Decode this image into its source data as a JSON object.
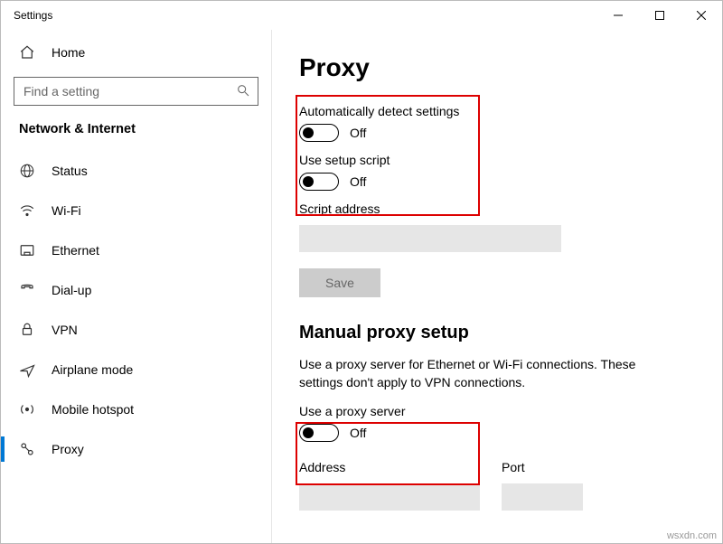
{
  "window": {
    "title": "Settings"
  },
  "sidebar": {
    "home": "Home",
    "search_placeholder": "Find a setting",
    "section": "Network & Internet",
    "items": [
      {
        "label": "Status"
      },
      {
        "label": "Wi-Fi"
      },
      {
        "label": "Ethernet"
      },
      {
        "label": "Dial-up"
      },
      {
        "label": "VPN"
      },
      {
        "label": "Airplane mode"
      },
      {
        "label": "Mobile hotspot"
      },
      {
        "label": "Proxy"
      }
    ]
  },
  "main": {
    "title": "Proxy",
    "auto_detect": {
      "label": "Automatically detect settings",
      "state": "Off"
    },
    "setup_script": {
      "label": "Use setup script",
      "state": "Off"
    },
    "script_address_label": "Script address",
    "save_label": "Save",
    "manual_title": "Manual proxy setup",
    "manual_desc": "Use a proxy server for Ethernet or Wi-Fi connections. These settings don't apply to VPN connections.",
    "use_proxy": {
      "label": "Use a proxy server",
      "state": "Off"
    },
    "address_label": "Address",
    "port_label": "Port"
  },
  "watermark": "wsxdn.com"
}
